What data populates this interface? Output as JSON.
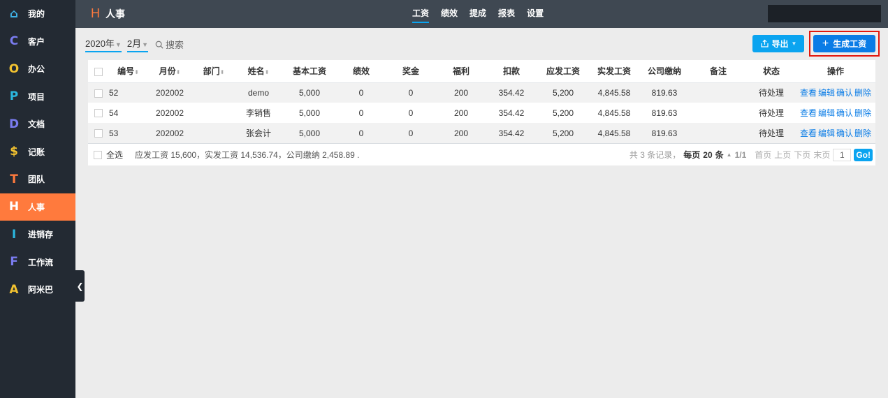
{
  "sidebar": {
    "items": [
      {
        "icon": "⌂",
        "label": "我的",
        "color": "#3fb2e6"
      },
      {
        "icon": "C",
        "label": "客户",
        "color": "#7a7cf0"
      },
      {
        "icon": "O",
        "label": "办公",
        "color": "#f2c230"
      },
      {
        "icon": "P",
        "label": "项目",
        "color": "#2bb8e0"
      },
      {
        "icon": "D",
        "label": "文档",
        "color": "#7a7cf0"
      },
      {
        "icon": "$",
        "label": "记账",
        "color": "#f2c230"
      },
      {
        "icon": "T",
        "label": "团队",
        "color": "#ff7a3d"
      },
      {
        "icon": "H",
        "label": "人事",
        "color": "#ffffff"
      },
      {
        "icon": "I",
        "label": "进销存",
        "color": "#2bb8e0"
      },
      {
        "icon": "F",
        "label": "工作流",
        "color": "#7a7cf0"
      },
      {
        "icon": "A",
        "label": "阿米巴",
        "color": "#f2c230"
      }
    ]
  },
  "header": {
    "logo": "H",
    "title": "人事",
    "tabs": [
      "工资",
      "绩效",
      "提成",
      "报表",
      "设置"
    ],
    "search_placeholder": ""
  },
  "filters": {
    "year": "2020年",
    "month": "2月",
    "search": "搜索"
  },
  "toolbar": {
    "export": "导出",
    "generate": "生成工资"
  },
  "table": {
    "columns": [
      "编号",
      "月份",
      "部门",
      "姓名",
      "基本工资",
      "绩效",
      "奖金",
      "福利",
      "扣款",
      "应发工资",
      "实发工资",
      "公司缴纳",
      "备注",
      "状态",
      "操作"
    ],
    "rows": [
      [
        "52",
        "202002",
        "",
        "demo",
        "5,000",
        "0",
        "0",
        "200",
        "354.42",
        "5,200",
        "4,845.58",
        "819.63",
        "",
        "待处理"
      ],
      [
        "54",
        "202002",
        "",
        "李销售",
        "5,000",
        "0",
        "0",
        "200",
        "354.42",
        "5,200",
        "4,845.58",
        "819.63",
        "",
        "待处理"
      ],
      [
        "53",
        "202002",
        "",
        "张会计",
        "5,000",
        "0",
        "0",
        "200",
        "354.42",
        "5,200",
        "4,845.58",
        "819.63",
        "",
        "待处理"
      ]
    ],
    "actions": [
      "查看",
      "编辑",
      "确认",
      "删除"
    ]
  },
  "footer": {
    "select_all": "全选",
    "summary": "应发工资 15,600，实发工资 14,536.74，公司缴纳 2,458.89 .",
    "total": "共 3 条记录，",
    "per_page_prefix": "每页",
    "per_page": "20",
    "per_page_suffix": "条",
    "page": "1/1",
    "first": "首页",
    "prev": "上页",
    "next": "下页",
    "last": "末页",
    "page_input": "1",
    "go": "Go!"
  }
}
